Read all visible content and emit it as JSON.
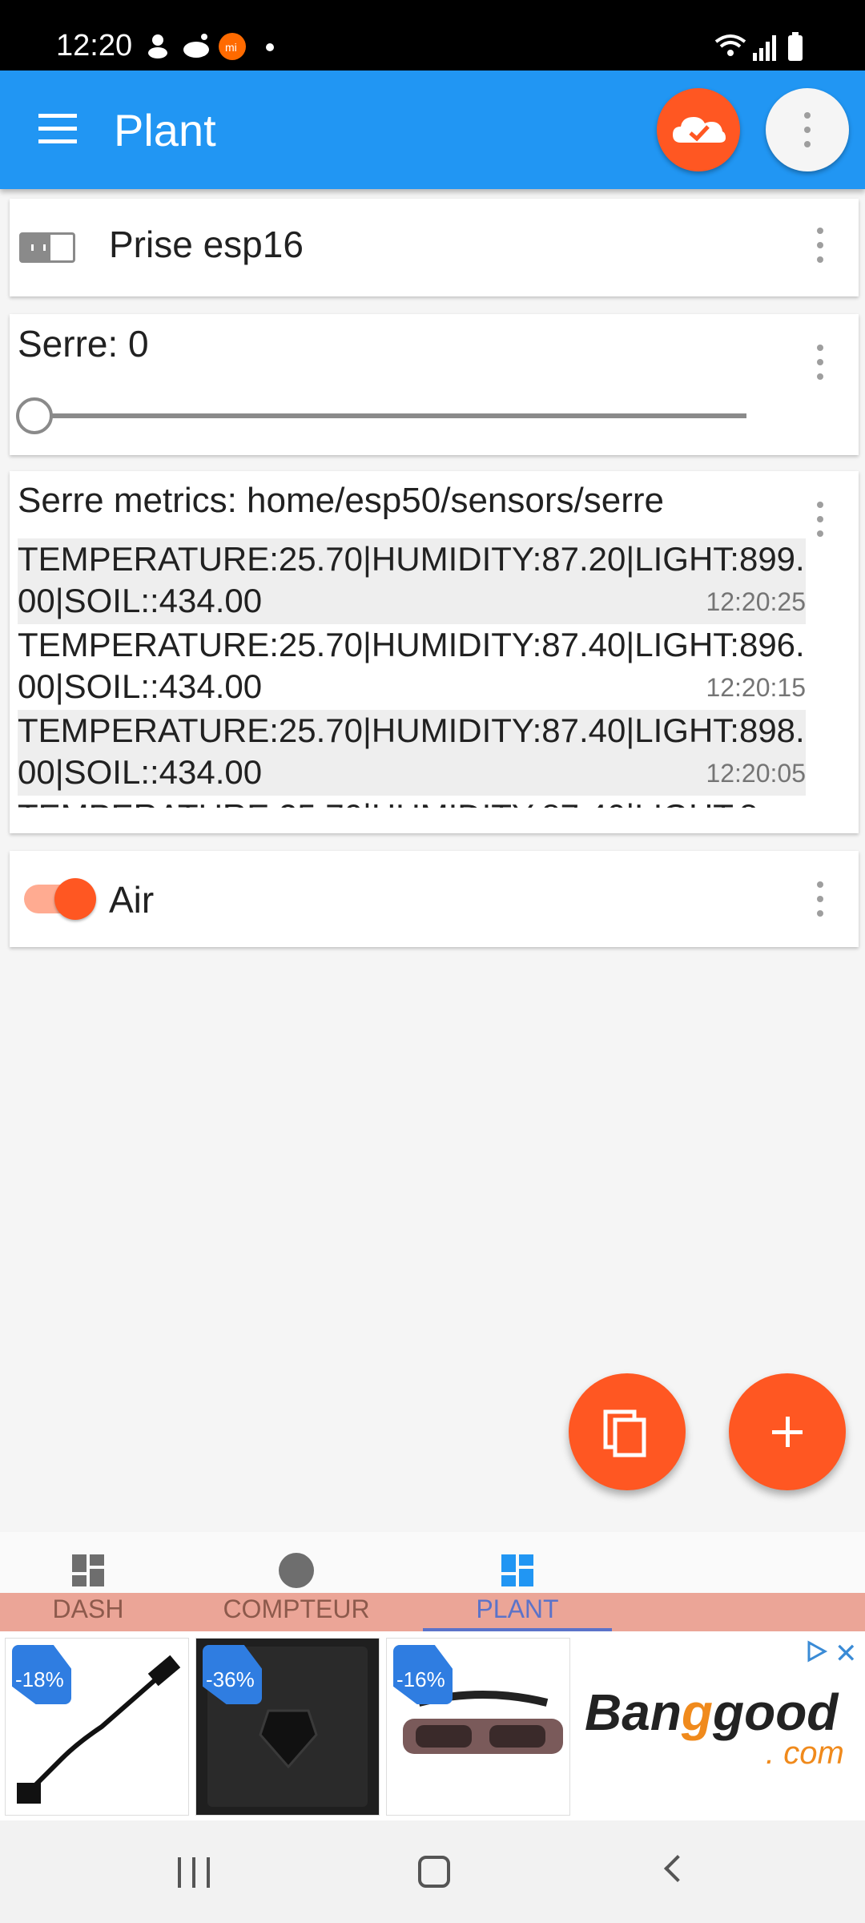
{
  "status_bar": {
    "time": "12:20"
  },
  "app_bar": {
    "title": "Plant",
    "menu_icon": "hamburger-menu-icon",
    "cloud_icon": "cloud-check-icon",
    "more_icon": "more-vert-icon"
  },
  "cards": {
    "switch_esp16": {
      "label": "Prise esp16",
      "state": "off"
    },
    "serre_slider": {
      "label": "Serre: 0",
      "value": 0
    },
    "serre_metrics": {
      "label": "Serre metrics: home/esp50/sensors/serre",
      "rows": [
        {
          "message": "TEMPERATURE:25.70|HUMIDITY:87.20|LIGHT:899.00|SOIL::434.00",
          "time": "12:20:25"
        },
        {
          "message": "TEMPERATURE:25.70|HUMIDITY:87.40|LIGHT:896.00|SOIL::434.00",
          "time": "12:20:15"
        },
        {
          "message": "TEMPERATURE:25.70|HUMIDITY:87.40|LIGHT:898.00|SOIL::434.00",
          "time": "12:20:05"
        },
        {
          "message": "TEMPERATURE:25.70|HUMIDITY:87.40|LIGHT:8",
          "time": ""
        }
      ]
    },
    "air_switch": {
      "label": "Air",
      "state": "on"
    }
  },
  "fabs": {
    "copy_icon": "copy-icon",
    "add_icon": "add-icon"
  },
  "tabs": [
    {
      "label": "DASH",
      "icon": "dashboard-icon",
      "active": false
    },
    {
      "label": "COMPTEUR",
      "icon": "circle-icon",
      "active": false
    },
    {
      "label": "PLANT",
      "icon": "dashboard-icon",
      "active": true
    }
  ],
  "ad": {
    "items": [
      {
        "discount": "-18%"
      },
      {
        "discount": "-36%"
      },
      {
        "discount": "-16%"
      }
    ],
    "brand_main": "Ban",
    "brand_g": "g",
    "brand_rest": "good",
    "brand_domain": ". com"
  },
  "colors": {
    "app_bar": "#2196f3",
    "accent": "#ff5722",
    "tab_active": "#5b73c9",
    "tab_stripe": "#eba597"
  }
}
